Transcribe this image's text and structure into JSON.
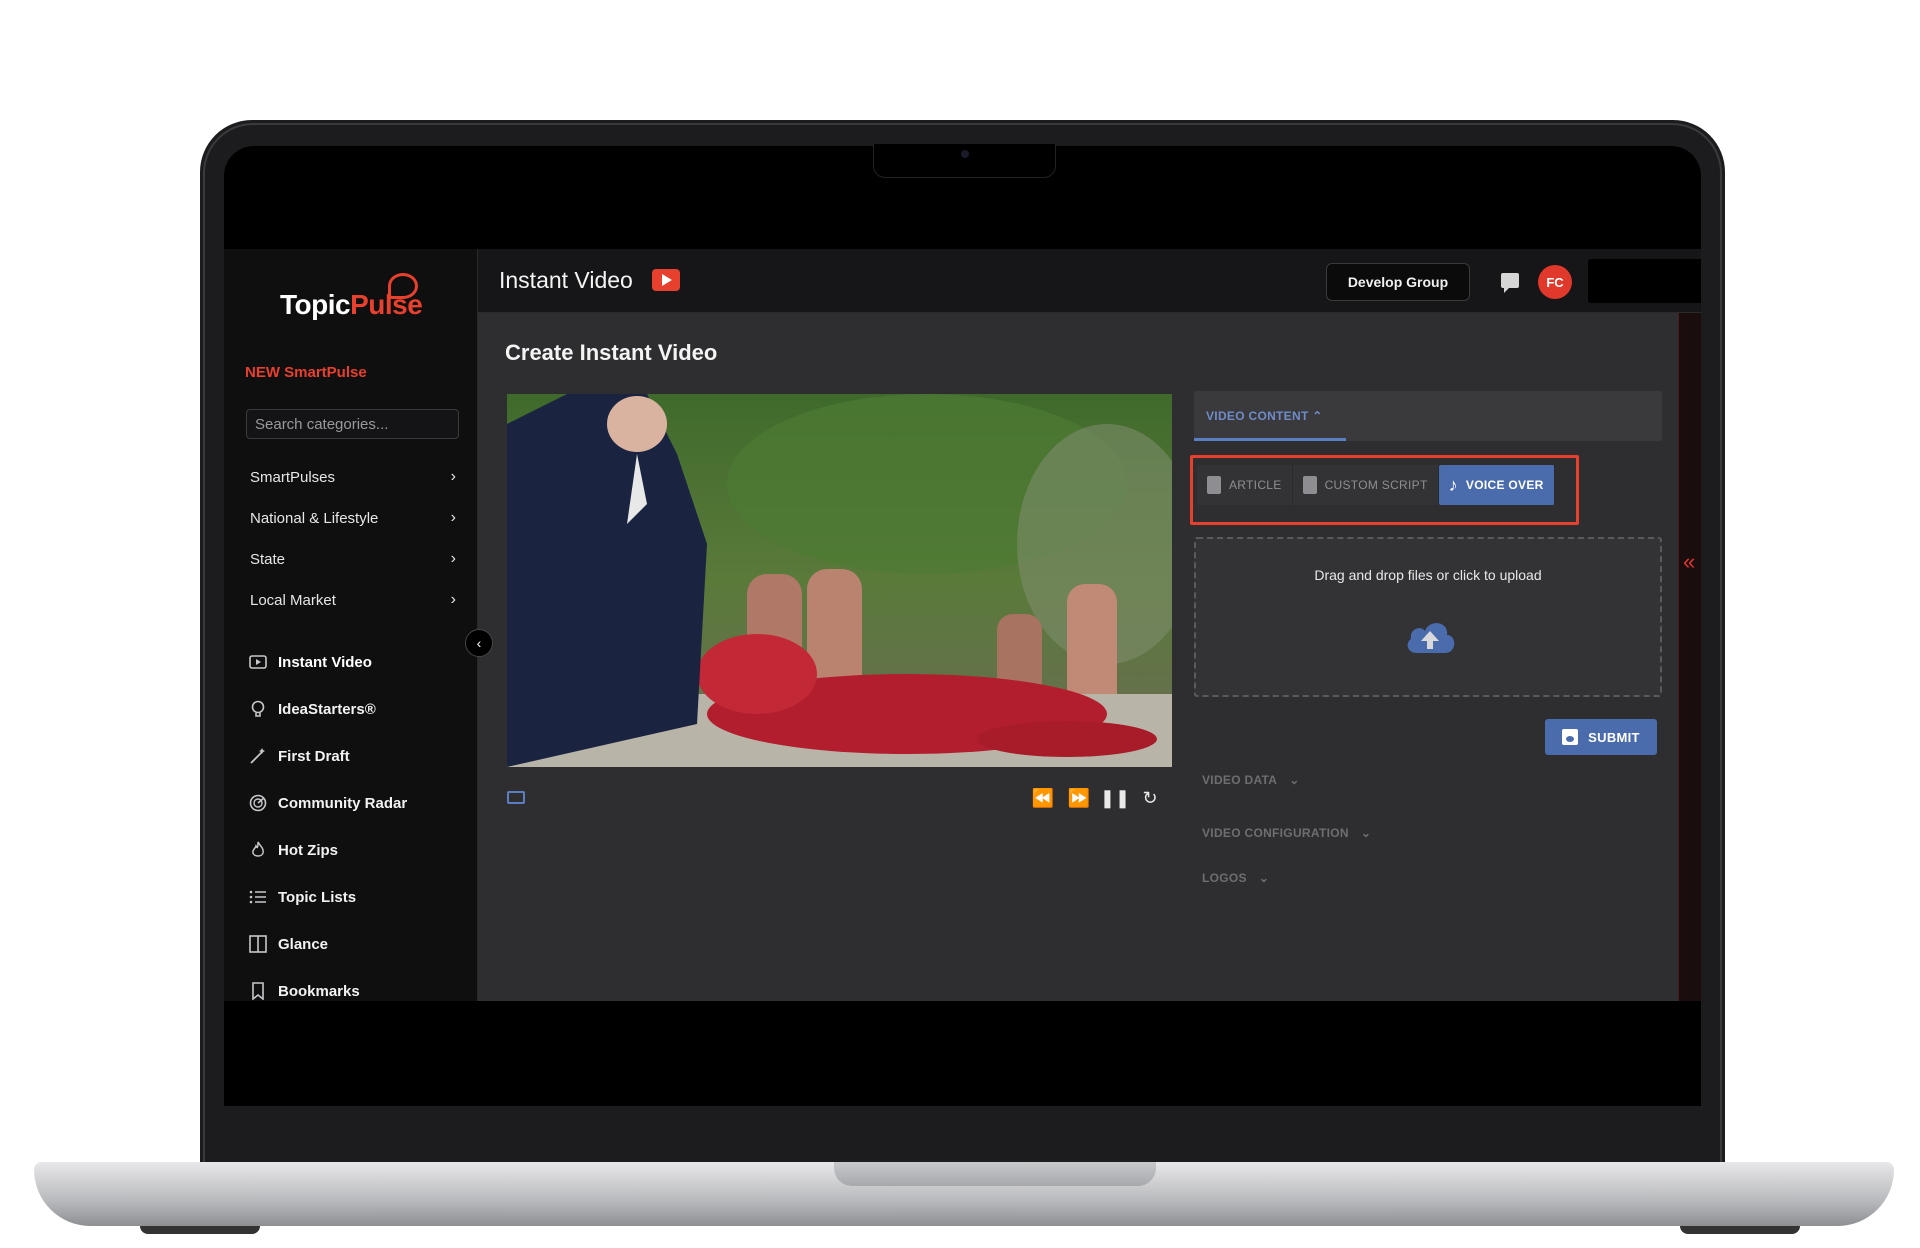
{
  "sidebar": {
    "logo_part1": "Topic",
    "logo_part2": "Pulse",
    "new_label": "NEW SmartPulse",
    "search_placeholder": "Search categories...",
    "categories": [
      "SmartPulses",
      "National & Lifestyle",
      "State",
      "Local Market"
    ],
    "nav": [
      {
        "label": "Instant Video",
        "icon": "video-icon"
      },
      {
        "label": "IdeaStarters®",
        "icon": "lightbulb-icon"
      },
      {
        "label": "First Draft",
        "icon": "magic-wand-icon"
      },
      {
        "label": "Community Radar",
        "icon": "radar-icon"
      },
      {
        "label": "Hot Zips",
        "icon": "flame-icon"
      },
      {
        "label": "Topic Lists",
        "icon": "list-icon"
      },
      {
        "label": "Glance",
        "icon": "panel-icon"
      },
      {
        "label": "Bookmarks",
        "icon": "bookmark-icon"
      }
    ]
  },
  "header": {
    "title": "Instant Video",
    "group_button": "Develop Group",
    "avatar_initials": "FC"
  },
  "main": {
    "title": "Create Instant Video",
    "video_content_tab": "VIDEO CONTENT",
    "content_types": [
      "ARTICLE",
      "CUSTOM SCRIPT",
      "VOICE OVER"
    ],
    "dropzone_text": "Drag and drop files or click to upload",
    "submit_label": "SUBMIT",
    "accordions": [
      "VIDEO DATA",
      "VIDEO CONFIGURATION",
      "LOGOS"
    ]
  },
  "colors": {
    "accent_red": "#e8402e",
    "accent_blue": "#4a6cad",
    "background": "#2e2e30"
  }
}
